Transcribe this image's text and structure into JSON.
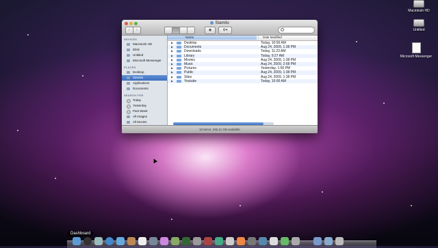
{
  "window": {
    "title": "Stamito",
    "status": "10 items, 245.11 GB available"
  },
  "sidebar": {
    "devices_heading": "DEVICES",
    "devices": [
      "Macintosh HD",
      "iDisk",
      "Untitled",
      "Microsoft Messenger"
    ],
    "places_heading": "PLACES",
    "places": [
      "Desktop",
      "Stamito",
      "Applications",
      "Documents"
    ],
    "search_heading": "SEARCH FOR",
    "search": [
      "Today",
      "Yesterday",
      "Past Week",
      "All Images",
      "All Movies",
      "All Documents"
    ],
    "selected": "Stamito"
  },
  "columns": {
    "name": "Name",
    "date": "Date Modified"
  },
  "files": [
    {
      "name": "Desktop",
      "date": "Today, 10:56 AM"
    },
    {
      "name": "Documents",
      "date": "Aug 24, 2009, 1:38 PM"
    },
    {
      "name": "Downloads",
      "date": "Today, 11:23 AM"
    },
    {
      "name": "Library",
      "date": "Today, 9:27 AM"
    },
    {
      "name": "Movies",
      "date": "Aug 24, 2009, 1:38 PM"
    },
    {
      "name": "Music",
      "date": "Aug 24, 2009, 2:58 PM"
    },
    {
      "name": "Pictures",
      "date": "Yesterday, 1:56 PM"
    },
    {
      "name": "Public",
      "date": "Aug 24, 2009, 1:38 PM"
    },
    {
      "name": "Sites",
      "date": "Aug 24, 2009, 1:38 PM"
    },
    {
      "name": "Youtube",
      "date": "Today, 10:00 AM"
    }
  ],
  "desktop_icons": [
    "Macintosh HD",
    "Untitled",
    "Microsoft Messenger"
  ],
  "dock": {
    "label": "Dashboard"
  },
  "icons": {
    "back": "chevron-left-icon",
    "forward": "chevron-right-icon",
    "quicklook": "eye-icon",
    "action": "gear-icon",
    "search": "search-icon"
  }
}
